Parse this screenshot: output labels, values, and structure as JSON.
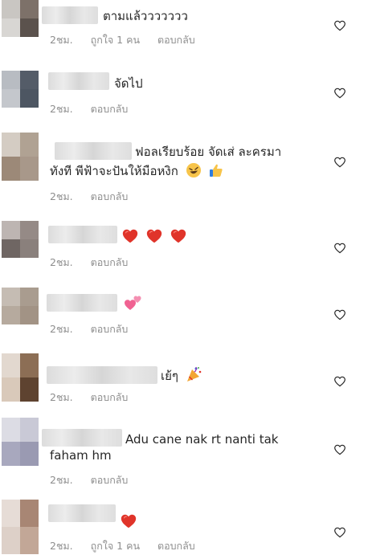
{
  "comments": [
    {
      "text": "ตามแล้ววววววว",
      "time": "2ชม.",
      "likes": "ถูกใจ 1 คน",
      "reply": "ตอบกลับ"
    },
    {
      "text": "จัดไป",
      "time": "2ชม.",
      "reply": "ตอบกลับ"
    },
    {
      "text_line1": "ฟอลเรียบร้อย จัดเส่ ละครมา",
      "text_line2": "ทังที พีฟ้าจะปันให้มือหงิก",
      "time": "2ชม.",
      "reply": "ตอบกลับ"
    },
    {
      "time": "2ชม.",
      "reply": "ตอบกลับ"
    },
    {
      "time": "2ชม.",
      "reply": "ตอบกลับ"
    },
    {
      "text": "เย้ๆ",
      "time": "2ชม.",
      "reply": "ตอบกลับ"
    },
    {
      "text_line1": "Adu cane nak rt nanti tak",
      "text_line2": "faham hm",
      "time": "2ชม.",
      "reply": "ตอบกลับ"
    },
    {
      "time": "2ชม.",
      "likes": "ถูกใจ 1 คน",
      "reply": "ตอบกลับ"
    }
  ],
  "icons": {
    "like": "heart-outline-icon",
    "red_heart": "red-heart-emoji",
    "two_hearts": "two-hearts-emoji",
    "rofl": "rofl-emoji",
    "thumbs_up": "thumbs-up-emoji",
    "party": "party-popper-emoji"
  },
  "colors": {
    "meta": "#8e8e8e",
    "text": "#262626",
    "heart": "#e0342a",
    "pink": "#f48fb1"
  }
}
